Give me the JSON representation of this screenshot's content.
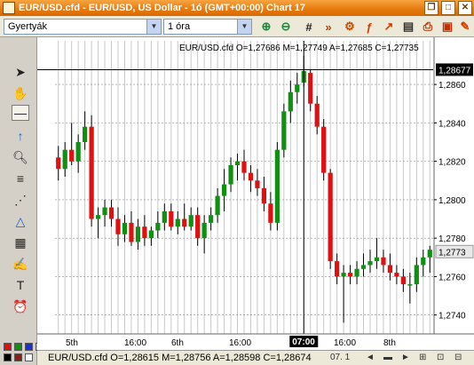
{
  "window": {
    "title": "EUR/USD.cfd - EUR/USD, US Dollar - 1ó (GMT+00:00)  Chart 17",
    "buttons": {
      "restore": "❐",
      "maximize": "□",
      "close": "✕"
    }
  },
  "toolbar": {
    "chart_type": "Gyertyák",
    "timeframe": "1 óra"
  },
  "chart": {
    "header": "EUR/USD.cfd O=1,27686 M=1,27749 A=1,27685 C=1,27735",
    "crosshair_price": "1,28677",
    "current_price": "1,2773",
    "crosshair_time": "07:00",
    "price_ticks": [
      {
        "label": "1,2860",
        "v": 1.286
      },
      {
        "label": "1,2840",
        "v": 1.284
      },
      {
        "label": "1,2820",
        "v": 1.282
      },
      {
        "label": "1,2800",
        "v": 1.28
      },
      {
        "label": "1,2780",
        "v": 1.278
      },
      {
        "label": "1,2760",
        "v": 1.276
      },
      {
        "label": "1,2740",
        "v": 1.274
      }
    ],
    "time_labels": [
      "5th",
      "16:00",
      "6th",
      "16:00",
      "16:00",
      "8th"
    ],
    "colors": {
      "up": "#109010",
      "down": "#e01010",
      "grid": "#c8c8c8",
      "wick": "#000000"
    }
  },
  "status_bar": {
    "ohlc": "EUR/USD.cfd O=1,28615 M=1,28756 A=1,28598 C=1,28674",
    "time_right": "07. 1"
  },
  "chart_data": {
    "type": "candlestick",
    "series": [
      {
        "o": 1.2822,
        "h": 1.2828,
        "l": 1.281,
        "c": 1.2816
      },
      {
        "o": 1.2816,
        "h": 1.283,
        "l": 1.2812,
        "c": 1.2826
      },
      {
        "o": 1.2826,
        "h": 1.284,
        "l": 1.2818,
        "c": 1.282
      },
      {
        "o": 1.282,
        "h": 1.2834,
        "l": 1.2814,
        "c": 1.283
      },
      {
        "o": 1.283,
        "h": 1.2846,
        "l": 1.2826,
        "c": 1.2838
      },
      {
        "o": 1.2838,
        "h": 1.2844,
        "l": 1.2786,
        "c": 1.279
      },
      {
        "o": 1.279,
        "h": 1.2796,
        "l": 1.278,
        "c": 1.2792
      },
      {
        "o": 1.2792,
        "h": 1.28,
        "l": 1.2786,
        "c": 1.2796
      },
      {
        "o": 1.2796,
        "h": 1.28,
        "l": 1.2786,
        "c": 1.279
      },
      {
        "o": 1.279,
        "h": 1.2796,
        "l": 1.2776,
        "c": 1.2782
      },
      {
        "o": 1.2782,
        "h": 1.2792,
        "l": 1.2778,
        "c": 1.2788
      },
      {
        "o": 1.2788,
        "h": 1.2794,
        "l": 1.2776,
        "c": 1.2778
      },
      {
        "o": 1.2778,
        "h": 1.279,
        "l": 1.2774,
        "c": 1.2786
      },
      {
        "o": 1.2786,
        "h": 1.2792,
        "l": 1.2776,
        "c": 1.278
      },
      {
        "o": 1.278,
        "h": 1.2786,
        "l": 1.2776,
        "c": 1.2784
      },
      {
        "o": 1.2784,
        "h": 1.2794,
        "l": 1.278,
        "c": 1.2788
      },
      {
        "o": 1.2788,
        "h": 1.2798,
        "l": 1.2784,
        "c": 1.2794
      },
      {
        "o": 1.2794,
        "h": 1.2798,
        "l": 1.2784,
        "c": 1.2786
      },
      {
        "o": 1.2786,
        "h": 1.2794,
        "l": 1.2782,
        "c": 1.279
      },
      {
        "o": 1.279,
        "h": 1.2798,
        "l": 1.2784,
        "c": 1.2786
      },
      {
        "o": 1.2786,
        "h": 1.2796,
        "l": 1.2784,
        "c": 1.2792
      },
      {
        "o": 1.2792,
        "h": 1.2796,
        "l": 1.2776,
        "c": 1.278
      },
      {
        "o": 1.278,
        "h": 1.2792,
        "l": 1.2772,
        "c": 1.2788
      },
      {
        "o": 1.2788,
        "h": 1.2796,
        "l": 1.2784,
        "c": 1.2792
      },
      {
        "o": 1.2792,
        "h": 1.2806,
        "l": 1.2788,
        "c": 1.2802
      },
      {
        "o": 1.2802,
        "h": 1.2816,
        "l": 1.2794,
        "c": 1.2808
      },
      {
        "o": 1.2808,
        "h": 1.2822,
        "l": 1.2804,
        "c": 1.2818
      },
      {
        "o": 1.2818,
        "h": 1.2824,
        "l": 1.281,
        "c": 1.282
      },
      {
        "o": 1.282,
        "h": 1.2826,
        "l": 1.281,
        "c": 1.2814
      },
      {
        "o": 1.2814,
        "h": 1.2818,
        "l": 1.2804,
        "c": 1.281
      },
      {
        "o": 1.281,
        "h": 1.2816,
        "l": 1.2802,
        "c": 1.2806
      },
      {
        "o": 1.2806,
        "h": 1.2812,
        "l": 1.2794,
        "c": 1.2798
      },
      {
        "o": 1.2798,
        "h": 1.2804,
        "l": 1.2784,
        "c": 1.2788
      },
      {
        "o": 1.2788,
        "h": 1.283,
        "l": 1.2784,
        "c": 1.2826
      },
      {
        "o": 1.2826,
        "h": 1.285,
        "l": 1.2822,
        "c": 1.2846
      },
      {
        "o": 1.2846,
        "h": 1.2862,
        "l": 1.284,
        "c": 1.2856
      },
      {
        "o": 1.2856,
        "h": 1.2866,
        "l": 1.285,
        "c": 1.286
      },
      {
        "o": 1.2861,
        "h": 1.2875,
        "l": 1.2859,
        "c": 1.2867
      },
      {
        "o": 1.2866,
        "h": 1.2868,
        "l": 1.2846,
        "c": 1.285
      },
      {
        "o": 1.285,
        "h": 1.2854,
        "l": 1.2834,
        "c": 1.2838
      },
      {
        "o": 1.2838,
        "h": 1.2842,
        "l": 1.281,
        "c": 1.2814
      },
      {
        "o": 1.2814,
        "h": 1.2816,
        "l": 1.2764,
        "c": 1.2768
      },
      {
        "o": 1.2768,
        "h": 1.2772,
        "l": 1.2756,
        "c": 1.276
      },
      {
        "o": 1.276,
        "h": 1.2766,
        "l": 1.2736,
        "c": 1.2762
      },
      {
        "o": 1.2762,
        "h": 1.2766,
        "l": 1.2756,
        "c": 1.276
      },
      {
        "o": 1.276,
        "h": 1.2768,
        "l": 1.2756,
        "c": 1.2764
      },
      {
        "o": 1.2764,
        "h": 1.2772,
        "l": 1.276,
        "c": 1.2766
      },
      {
        "o": 1.2766,
        "h": 1.2774,
        "l": 1.2762,
        "c": 1.2768
      },
      {
        "o": 1.2768,
        "h": 1.278,
        "l": 1.2764,
        "c": 1.277
      },
      {
        "o": 1.277,
        "h": 1.2774,
        "l": 1.2762,
        "c": 1.2766
      },
      {
        "o": 1.2766,
        "h": 1.2772,
        "l": 1.2758,
        "c": 1.2762
      },
      {
        "o": 1.2762,
        "h": 1.2766,
        "l": 1.2756,
        "c": 1.276
      },
      {
        "o": 1.276,
        "h": 1.2764,
        "l": 1.2752,
        "c": 1.2756
      },
      {
        "o": 1.2756,
        "h": 1.2762,
        "l": 1.2746,
        "c": 1.2756
      },
      {
        "o": 1.2756,
        "h": 1.277,
        "l": 1.2752,
        "c": 1.2766
      },
      {
        "o": 1.2766,
        "h": 1.2774,
        "l": 1.276,
        "c": 1.277
      },
      {
        "o": 1.277,
        "h": 1.2776,
        "l": 1.2762,
        "c": 1.2774
      }
    ]
  }
}
